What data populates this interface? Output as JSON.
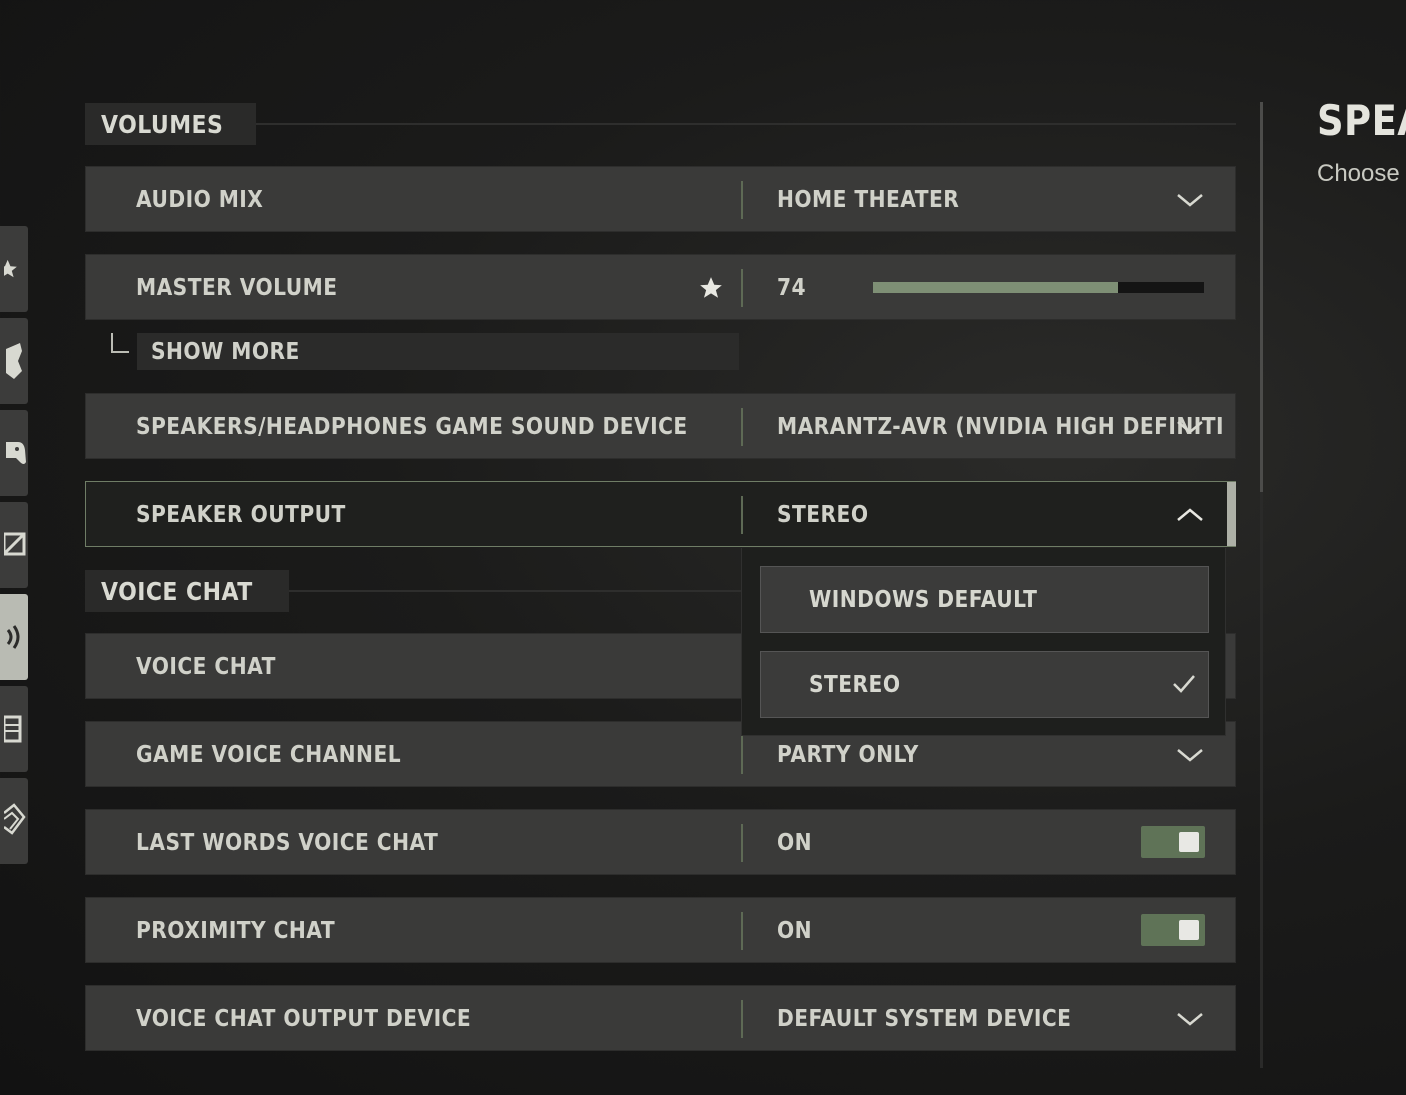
{
  "sections": {
    "volumes": "VOLUMES",
    "voice_chat": "VOICE CHAT"
  },
  "rows": {
    "audio_mix": {
      "label": "AUDIO MIX",
      "value": "HOME THEATER"
    },
    "master_volume": {
      "label": "MASTER VOLUME",
      "value": "74",
      "fill_fraction": 0.74
    },
    "show_more": "SHOW MORE",
    "sound_device": {
      "label": "SPEAKERS/HEADPHONES GAME SOUND DEVICE",
      "value": "MARANTZ-AVR (NVIDIA HIGH DEFINITI"
    },
    "speaker_output": {
      "label": "SPEAKER OUTPUT",
      "value": "STEREO"
    },
    "voice_chat": {
      "label": "VOICE CHAT"
    },
    "game_voice_channel": {
      "label": "GAME VOICE CHANNEL",
      "value": "PARTY ONLY"
    },
    "last_words": {
      "label": "LAST WORDS VOICE CHAT",
      "value": "ON"
    },
    "proximity": {
      "label": "PROXIMITY CHAT",
      "value": "ON"
    },
    "voice_output_device": {
      "label": "VOICE CHAT OUTPUT DEVICE",
      "value": "DEFAULT SYSTEM DEVICE"
    }
  },
  "dropdown": {
    "options": [
      {
        "label": "WINDOWS DEFAULT",
        "selected": false
      },
      {
        "label": "STEREO",
        "selected": true
      }
    ]
  },
  "right_panel": {
    "title": "SPEA",
    "description": "Choose"
  },
  "nav_icons": [
    "star-icon",
    "shield-icon",
    "controller-icon",
    "display-icon",
    "audio-icon",
    "document-icon",
    "network-icon"
  ],
  "colors": {
    "accent": "#7e8f75",
    "toggle_on": "#5f7357",
    "row_bg": "#3a3a39"
  }
}
